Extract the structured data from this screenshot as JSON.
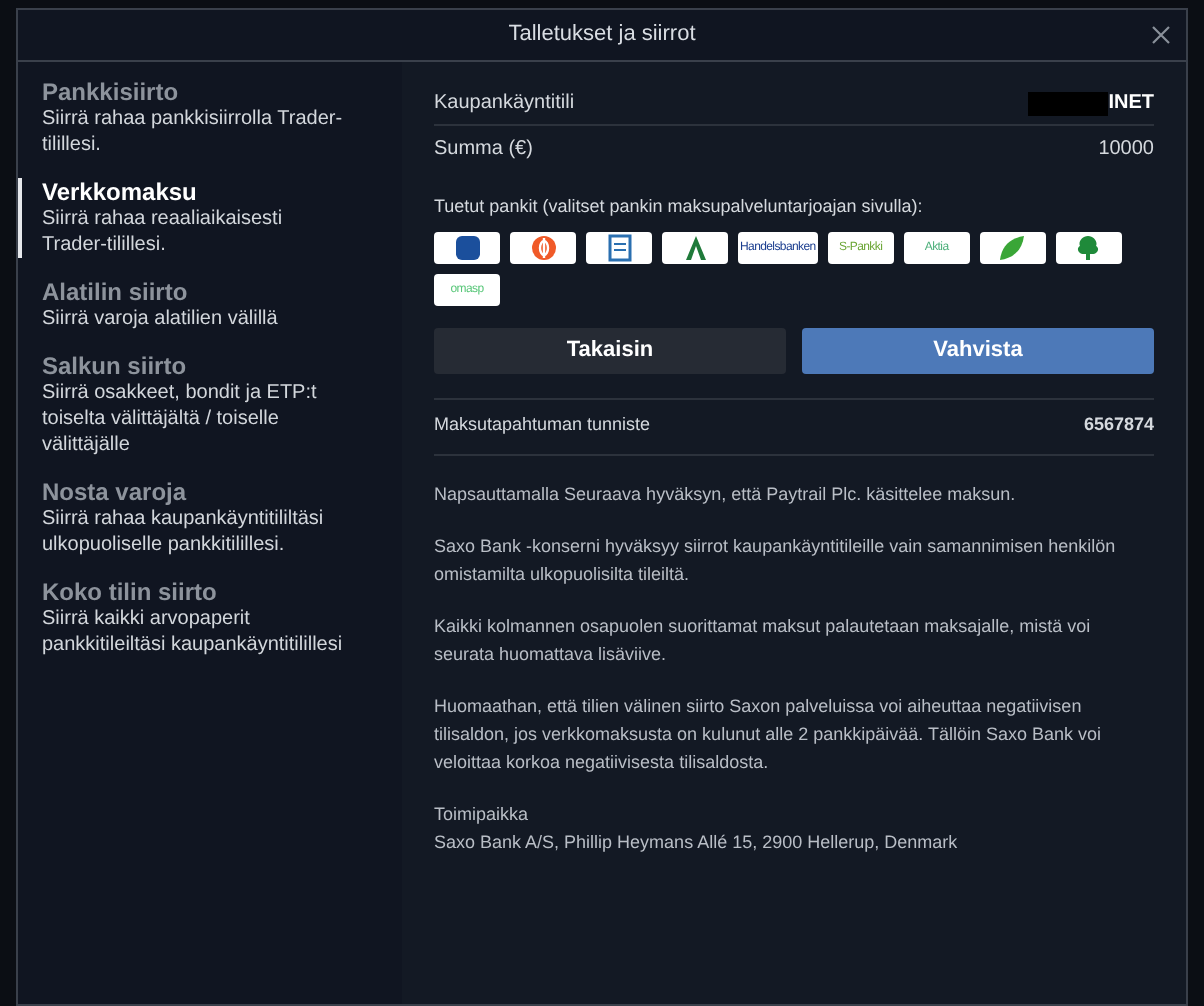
{
  "window": {
    "title": "Talletukset ja siirrot"
  },
  "sidebar": {
    "items": [
      {
        "title": "Pankkisiirto",
        "description": "Siirrä rahaa pankkisiirrolla Trader-tilillesi.",
        "selected": false
      },
      {
        "title": "Verkkomaksu",
        "description": "Siirrä rahaa reaaliaikaisesti Trader-tilillesi.",
        "selected": true
      },
      {
        "title": "Alatilin siirto",
        "description": "Siirrä varoja alatilien välillä",
        "selected": false
      },
      {
        "title": "Salkun siirto",
        "description": "Siirrä osakkeet, bondit ja ETP:t toiselta välittäjältä / toiselle välittäjälle",
        "selected": false
      },
      {
        "title": "Nosta varoja",
        "description": "Siirrä rahaa kaupankäyntitililtäsi ulkopuoliselle pankkitilillesi.",
        "selected": false
      },
      {
        "title": "Koko tilin siirto",
        "description": "Siirrä kaikki arvopaperit pankkitileiltäsi kaupankäyntitilillesi",
        "selected": false
      }
    ]
  },
  "form": {
    "fields": [
      {
        "label": "Kaupankäyntitili",
        "value": "INET",
        "redacted": true
      },
      {
        "label": "Summa (€)",
        "value": "10000"
      }
    ]
  },
  "banks": {
    "label": "Tuetut pankit (valitset pankin maksupalveluntarjoajan sivulla):",
    "items": [
      {
        "kind": "square",
        "color": "#1b4f9c"
      },
      {
        "kind": "circle",
        "color": "#f05a28"
      },
      {
        "kind": "doc",
        "color": "#2a6fb0"
      },
      {
        "kind": "letter",
        "color": "#1f7a3a"
      },
      {
        "kind": "text",
        "label": "Handelsbanken",
        "color": "#1a3d8f"
      },
      {
        "kind": "text",
        "label": "S-Pankki",
        "color": "#6aa534"
      },
      {
        "kind": "text",
        "label": "Aktia",
        "color": "#4caf7a"
      },
      {
        "kind": "leaf",
        "color": "#3aa637"
      },
      {
        "kind": "tree",
        "color": "#1f8a3a"
      },
      {
        "kind": "text",
        "label": "omasp",
        "color": "#5ac77a"
      }
    ]
  },
  "buttons": [
    {
      "label": "Takaisin",
      "kind": "secondary"
    },
    {
      "label": "Vahvista",
      "kind": "primary"
    }
  ],
  "transaction": {
    "label": "Maksutapahtuman tunniste",
    "value": "6567874"
  },
  "paragraphs": [
    "Napsauttamalla Seuraava hyväksyn, että Paytrail Plc. käsittelee maksun.",
    "Saxo Bank -konserni hyväksyy siirrot kaupankäyntitileille vain samannimisen henkilön omistamilta ulkopuolisilta tileiltä.",
    "Kaikki kolmannen osapuolen suorittamat maksut palautetaan maksajalle, mistä voi seurata huomattava lisäviive.",
    "Huomaathan, että tilien välinen siirto Saxon palveluissa voi aiheuttaa negatiivisen tilisaldon, jos verkkomaksusta on kulunut alle 2 pankkipäivää. Tällöin Saxo Bank voi veloittaa korkoa negatiivisesta tilisaldosta."
  ],
  "footer": {
    "lines": [
      "Toimipaikka",
      "Saxo Bank A/S, Phillip Heymans Allé 15, 2900 Hellerup, Denmark"
    ]
  }
}
